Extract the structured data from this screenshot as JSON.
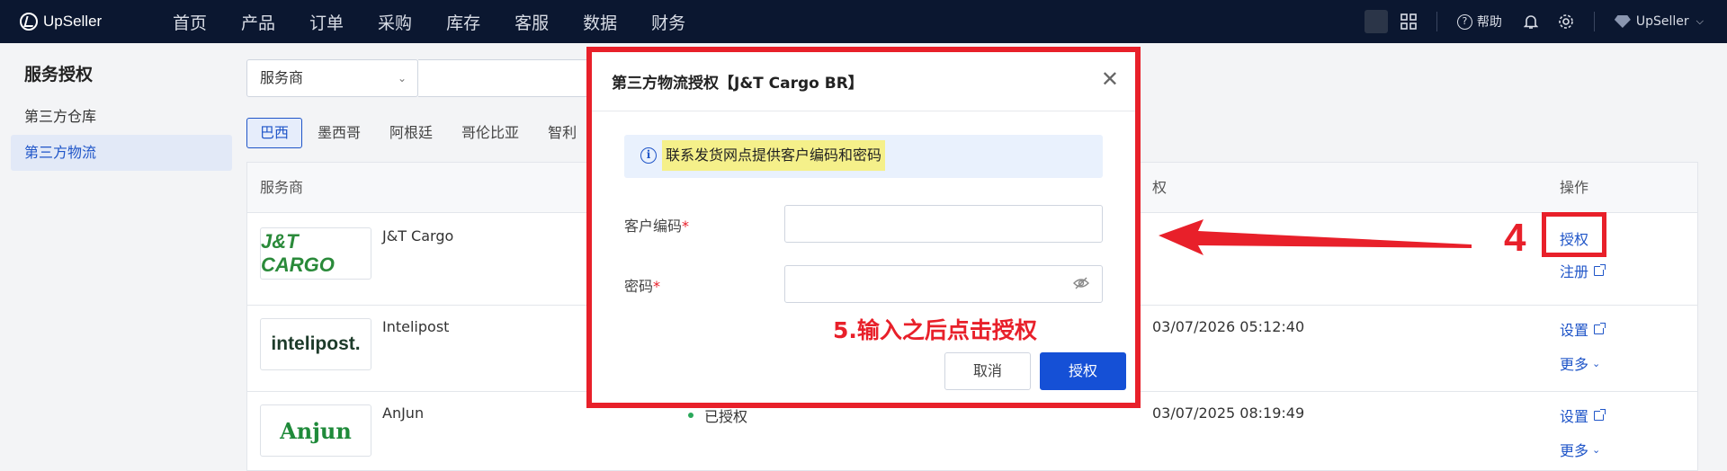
{
  "app": {
    "brand": "UpSeller"
  },
  "topnav": {
    "items": [
      "首页",
      "产品",
      "订单",
      "采购",
      "库存",
      "客服",
      "数据",
      "财务"
    ],
    "help": "帮助",
    "user": "UpSeller"
  },
  "sidebar": {
    "title": "服务授权",
    "items": [
      "第三方仓库",
      "第三方物流"
    ]
  },
  "filter": {
    "select_value": "服务商"
  },
  "country_tabs": [
    "巴西",
    "墨西哥",
    "阿根廷",
    "哥伦比亚",
    "智利"
  ],
  "table": {
    "headers": {
      "provider": "服务商",
      "time_partial": "权",
      "action": "操作"
    },
    "rows": [
      {
        "logo": "J&T CARGO",
        "name": "J&T Cargo",
        "status": "",
        "time": "",
        "actions": [
          "授权",
          "注册"
        ]
      },
      {
        "logo": "intelipost.",
        "name": "Intelipost",
        "status": "",
        "time": "03/07/2026 05:12:40",
        "actions": [
          "设置",
          "更多"
        ]
      },
      {
        "logo": "Anjun",
        "name": "AnJun",
        "status": "已授权",
        "time": "03/07/2025 08:19:49",
        "actions": [
          "设置",
          "更多"
        ]
      }
    ]
  },
  "modal": {
    "title": "第三方物流授权【J&T Cargo BR】",
    "notice": "联系发货网点提供客户编码和密码",
    "fields": [
      {
        "label": "客户编码",
        "required_mark": "*",
        "value": ""
      },
      {
        "label": "密码",
        "required_mark": "*",
        "value": ""
      }
    ],
    "cancel": "取消",
    "confirm": "授权"
  },
  "annotations": {
    "step4": "4",
    "instruction": "5.输入之后点击授权",
    "color": "#e8202a"
  },
  "colors": {
    "primary": "#1550d6",
    "nav_bg": "#0b1730",
    "link": "#1f55c8"
  }
}
